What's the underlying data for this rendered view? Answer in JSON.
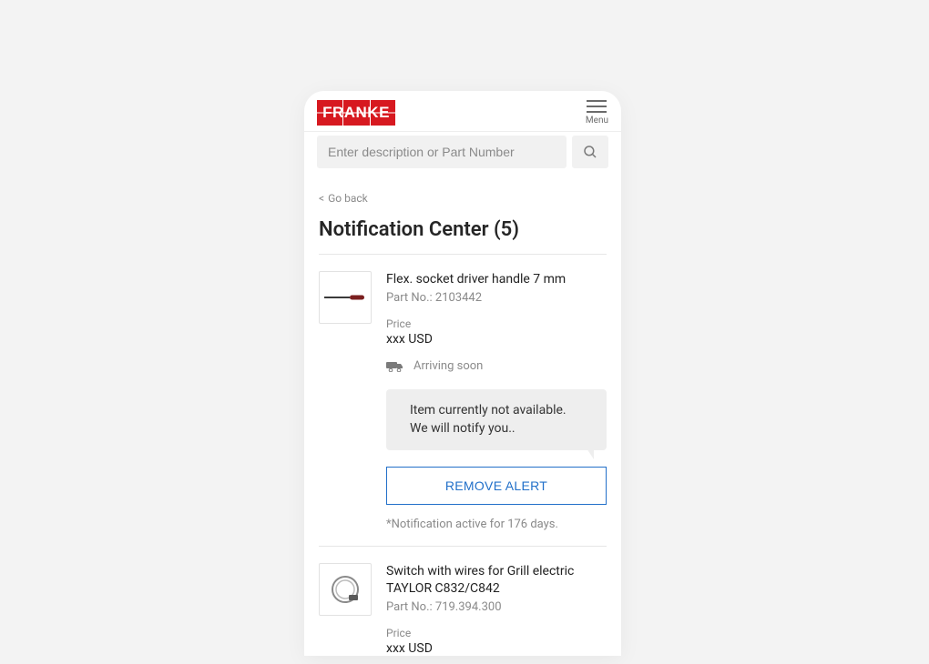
{
  "brand": "FRANKE",
  "menu_label": "Menu",
  "search": {
    "placeholder": "Enter description or Part Number"
  },
  "goback": {
    "chev": "<",
    "label": "Go back"
  },
  "page_title": "Notification Center (5)",
  "items": [
    {
      "title": "Flex. socket driver handle 7 mm",
      "partno_label": "Part No.: 2103442",
      "price_label": "Price",
      "price_value": "xxx USD",
      "arriving": "Arriving soon",
      "bubble_line1": "Item currently not available.",
      "bubble_line2": "We will notify you..",
      "remove_label": "REMOVE ALERT",
      "footnote": "*Notification active for 176 days."
    },
    {
      "title": "Switch with wires for Grill electric TAYLOR C832/C842",
      "partno_label": "Part No.: 719.394.300",
      "price_label": "Price",
      "price_value": "xxx USD"
    }
  ]
}
